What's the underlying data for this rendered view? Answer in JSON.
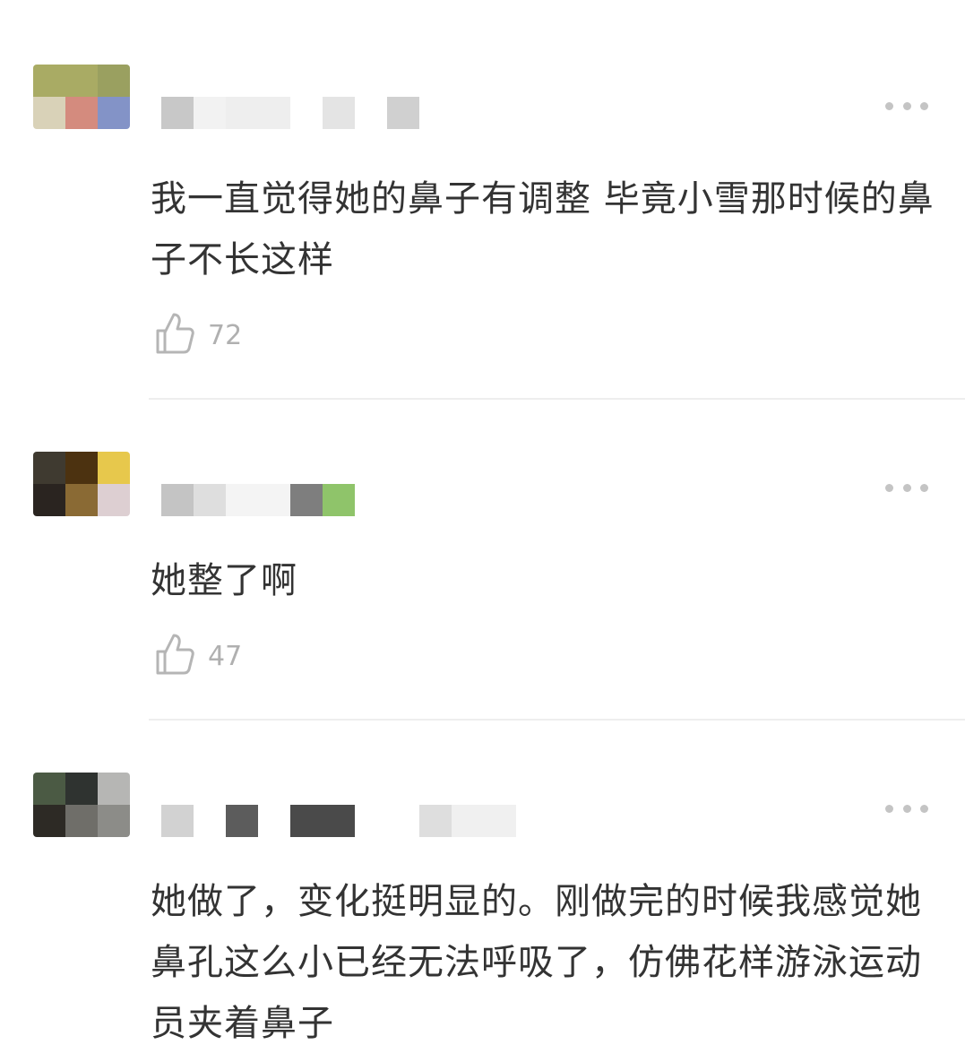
{
  "comments": [
    {
      "text": "我一直觉得她的鼻子有调整 毕竟小雪那时候的鼻子不长这样",
      "likes": "72",
      "avatar_colors": [
        "#a9ab64",
        "#a9ab64",
        "#9aa060",
        "#d9d2b8",
        "#d48b7e",
        "#8393c7"
      ],
      "name_blocks": [
        "#c8c8c8",
        "#f2f2f2",
        "#eeeeee",
        "#e4e4e4",
        "#d0d0d0"
      ]
    },
    {
      "text": "她整了啊",
      "likes": "47",
      "avatar_colors": [
        "#3f3a30",
        "#4c3210",
        "#e7c84c",
        "#2a2420",
        "#8a6a34",
        "#ddcfd2"
      ],
      "name_blocks": [
        "#c4c4c4",
        "#dedede",
        "#f4f4f4",
        "#7e7e7e",
        "#8fc46a"
      ]
    },
    {
      "text": "她做了，变化挺明显的。刚做完的时候我感觉她鼻孔这么小已经无法呼吸了，仿佛花样游泳运动员夹着鼻子",
      "avatar_colors": [
        "#4b5a44",
        "#2f3330",
        "#b6b6b4",
        "#2d2a25",
        "#6f6e69",
        "#8c8c88"
      ],
      "name_blocks": [
        "#d2d2d2",
        "#5c5c5c",
        "#4a4a4a",
        "#dedede",
        "#f0f0f0"
      ]
    }
  ],
  "icons": {
    "more": "more-dots-icon",
    "like": "thumbs-up-icon"
  }
}
